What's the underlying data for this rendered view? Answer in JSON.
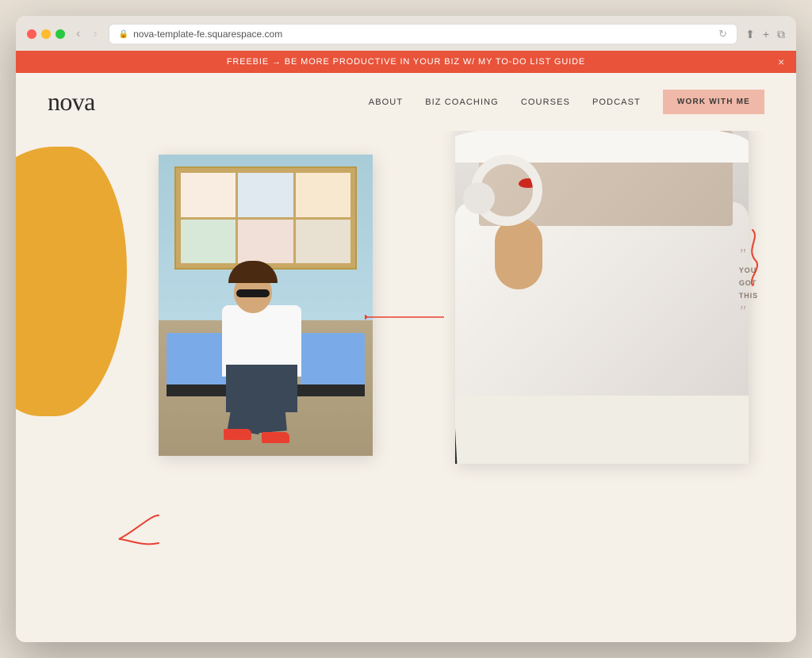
{
  "browser": {
    "url": "nova-template-fe.squarespace.com",
    "tab_icon": "🔒"
  },
  "banner": {
    "text": "FREEBIE → BE MORE PRODUCTIVE IN YOUR BIZ W/ MY TO-DO LIST GUIDE",
    "close_label": "×",
    "bg_color": "#e8533a"
  },
  "nav": {
    "logo": "nova",
    "links": [
      {
        "label": "ABOUT",
        "id": "about"
      },
      {
        "label": "BIZ COACHING",
        "id": "biz-coaching"
      },
      {
        "label": "COURSES",
        "id": "courses"
      },
      {
        "label": "PODCAST",
        "id": "podcast"
      }
    ],
    "cta_label": "WORK WITH ME"
  },
  "quote": {
    "open_mark": "\"",
    "lines": [
      "YOU",
      "GOT",
      "THIS"
    ],
    "close_mark": "\""
  },
  "colors": {
    "background": "#f5f0e8",
    "banner": "#e8533a",
    "blob": "#e8a832",
    "cta_bg": "#f0b8a8",
    "accent_red": "#e84030",
    "quote_color": "#9a8a80"
  }
}
